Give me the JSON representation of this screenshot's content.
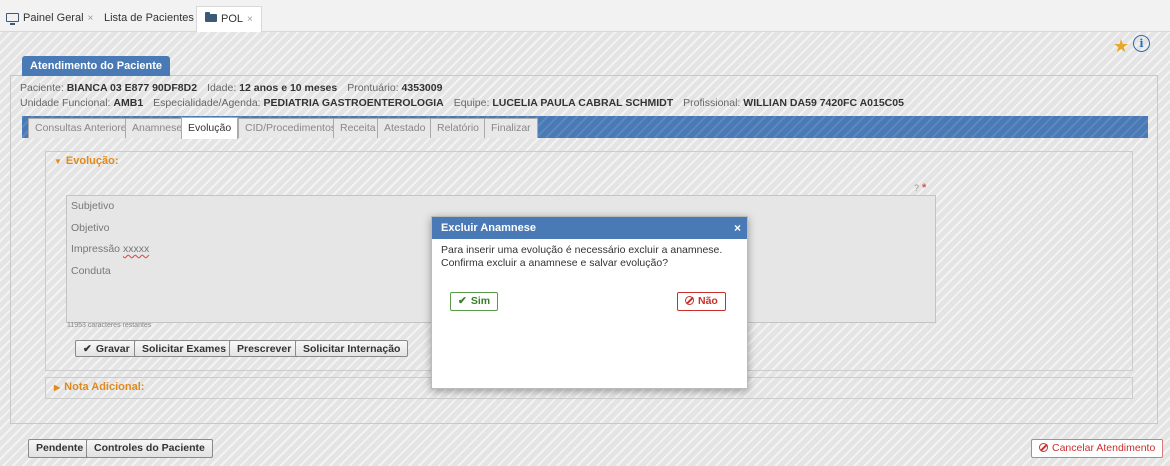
{
  "tabs": [
    {
      "label": "Painel Geral",
      "close": "×"
    },
    {
      "label": "Lista de Pacientes",
      "close": "×"
    },
    {
      "label": "POL",
      "close": "×"
    }
  ],
  "panel": {
    "title": "Atendimento do Paciente",
    "patient_line": {
      "paciente_label": "Paciente:",
      "paciente": "BIANCA 03 E877 90DF8D2",
      "idade_label": "Idade:",
      "idade": "12 anos e 10 meses",
      "prontuario_label": "Prontuário:",
      "prontuario": "4353009"
    },
    "unit_line": {
      "unidade_label": "Unidade Funcional:",
      "unidade": "AMB1",
      "especialidade_label": "Especialidade/Agenda:",
      "especialidade": "PEDIATRIA GASTROENTEROLOGIA",
      "equipe_label": "Equipe:",
      "equipe": "LUCELIA PAULA CABRAL SCHMIDT",
      "profissional_label": "Profissional:",
      "profissional": "WILLIAN DA59 7420FC A015C05"
    },
    "tabs": [
      "Consultas Anteriores",
      "Anamnese",
      "Evolução",
      "CID/Procedimentos",
      "Receita",
      "Atestado",
      "Relatório",
      "Finalizar"
    ],
    "active_tab": "Evolução"
  },
  "evolucao": {
    "title": "Evolução:",
    "help": "?",
    "required": "*",
    "lines": [
      "Subjetivo",
      "Objetivo",
      "Impressão ",
      "xxxxx",
      "Conduta"
    ],
    "chars_remaining": "11953 caracteres restantes",
    "buttons": {
      "gravar": "Gravar",
      "exames": "Solicitar Exames",
      "prescrever": "Prescrever",
      "internacao": "Solicitar Internação"
    }
  },
  "nota": {
    "title": "Nota Adicional:"
  },
  "modal": {
    "title": "Excluir Anamnese",
    "close": "×",
    "line1": "Para inserir uma evolução é necessário excluir a anamnese.",
    "line2": "Confirma excluir a anamnese e salvar evolução?",
    "yes": "Sim",
    "no": "Não"
  },
  "footer": {
    "pendente": "Pendente",
    "controles": "Controles do Paciente",
    "cancelar": "Cancelar Atendimento"
  },
  "icons": [
    "monitor-icon",
    "folder-icon",
    "star-icon",
    "info-icon",
    "check-icon",
    "ban-icon",
    "caret-icon"
  ],
  "colors": {
    "accent": "#4a7ab5",
    "section_title": "#e08a1e",
    "danger": "#c9302c",
    "success": "#3a7d2a",
    "star": "#e6a82a"
  }
}
